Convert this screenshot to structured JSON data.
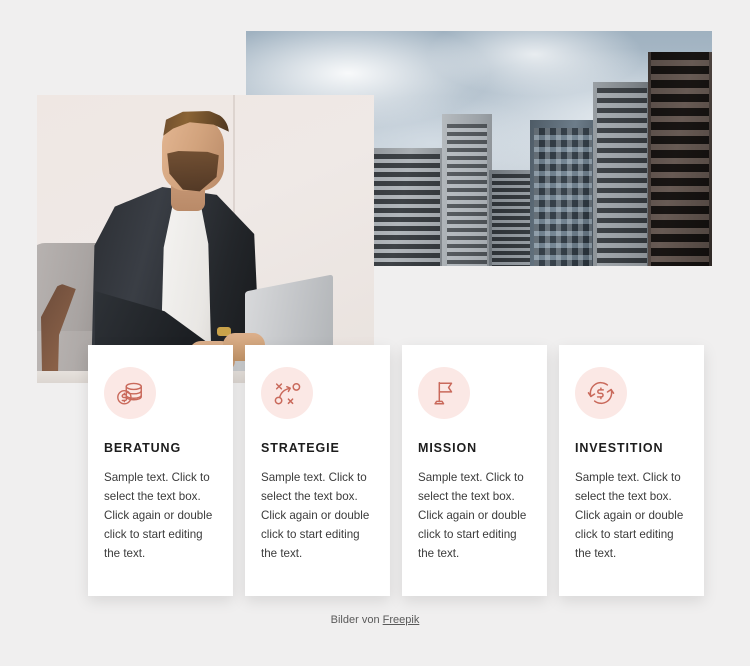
{
  "theme": {
    "background": "#f0efef",
    "card_background": "#ffffff",
    "icon_circle": "#fbe8e5",
    "icon_stroke": "#c9695b",
    "title_color": "#1d1d1d",
    "body_color": "#3b3b3b"
  },
  "media": {
    "city_photo": {
      "alt": "Modern city skyscrapers under a cloudy sky"
    },
    "person_photo": {
      "alt": "Bearded businessman in a dark blazer working on a laptop"
    }
  },
  "cards": [
    {
      "icon": "coins-stack-dollar-icon",
      "title": "BERATUNG",
      "text": "Sample text. Click to select the text box. Click again or double click to start editing the text."
    },
    {
      "icon": "strategy-playbook-icon",
      "title": "STRATEGIE",
      "text": "Sample text. Click to select the text box. Click again or double click to start editing the text."
    },
    {
      "icon": "flag-icon",
      "title": "MISSION",
      "text": "Sample text. Click to select the text box. Click again or double click to start editing the text."
    },
    {
      "icon": "dollar-refresh-icon",
      "title": "INVESTITION",
      "text": "Sample text. Click to select the text box. Click again or double click to start editing the text."
    }
  ],
  "footer": {
    "prefix": "Bilder von ",
    "link_label": "Freepik"
  }
}
